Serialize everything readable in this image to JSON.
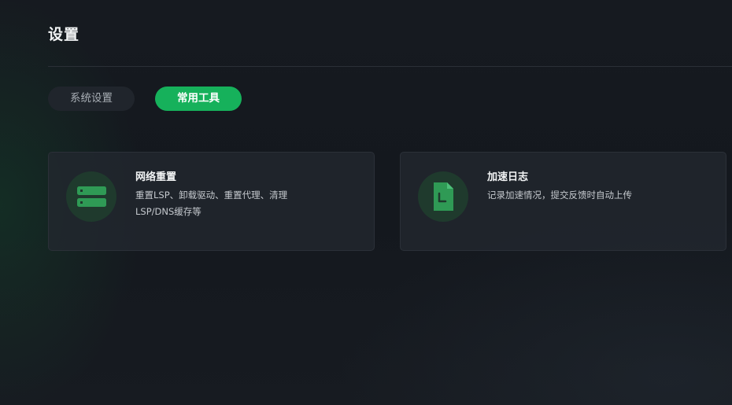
{
  "header": {
    "title": "设置"
  },
  "tabs": [
    {
      "label": "系统设置",
      "active": false
    },
    {
      "label": "常用工具",
      "active": true
    }
  ],
  "cards": [
    {
      "title": "网络重置",
      "desc": "重置LSP、卸载驱动、重置代理、清理LSP/DNS缓存等",
      "icon": "server-icon"
    },
    {
      "title": "加速日志",
      "desc": "记录加速情况，提交反馈时自动上传",
      "icon": "log-file-icon"
    }
  ],
  "colors": {
    "accent": "#16b15b",
    "background": "#13171d",
    "card": "#232830"
  }
}
